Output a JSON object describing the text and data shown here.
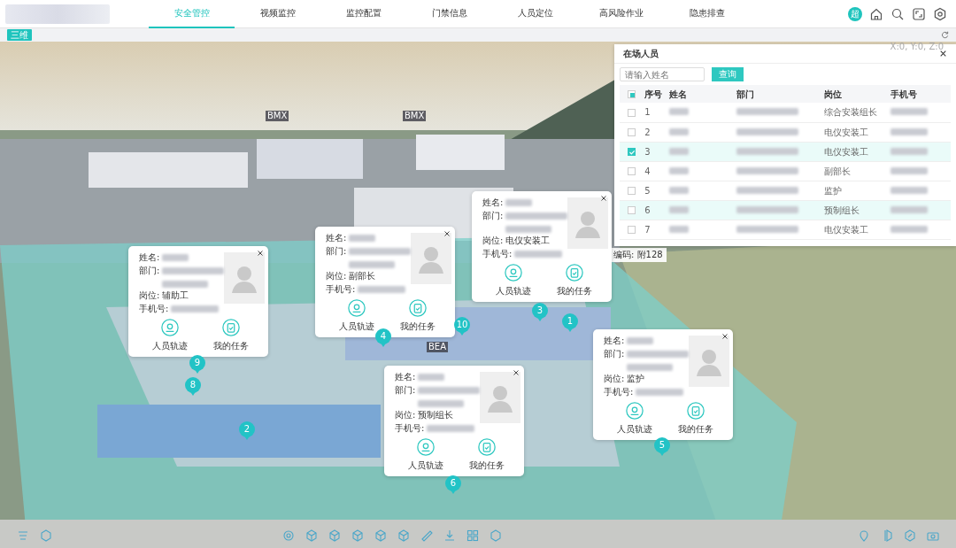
{
  "nav": {
    "tabs": [
      {
        "label": "安全管控",
        "selected": true
      },
      {
        "label": "视频监控",
        "selected": false
      },
      {
        "label": "监控配置",
        "selected": false
      },
      {
        "label": "门禁信息",
        "selected": false
      },
      {
        "label": "人员定位",
        "selected": false
      },
      {
        "label": "高风险作业",
        "selected": false
      },
      {
        "label": "隐患排查",
        "selected": false
      }
    ],
    "user_badge": "超"
  },
  "toolbar": {
    "view_button": "三维"
  },
  "scene": {
    "coordinates": "X:0, Y:0, Z:0",
    "building_labels": [
      "BMX",
      "BMX",
      "BEA"
    ],
    "tooltip": "编码: 附128",
    "markers": [
      "1",
      "2",
      "3",
      "4",
      "5",
      "6",
      "8",
      "9",
      "10"
    ]
  },
  "person_cards": [
    {
      "labels": [
        "姓名:",
        "部门:",
        "岗位:",
        "手机号:"
      ],
      "position": "辅助工",
      "actions": [
        "人员轨迹",
        "我的任务"
      ]
    },
    {
      "labels": [
        "姓名:",
        "部门:",
        "岗位:",
        "手机号:"
      ],
      "position": "副部长",
      "actions": [
        "人员轨迹",
        "我的任务"
      ]
    },
    {
      "labels": [
        "姓名:",
        "部门:",
        "岗位:",
        "手机号:"
      ],
      "position": "电仪安装工",
      "actions": [
        "人员轨迹",
        "我的任务"
      ]
    },
    {
      "labels": [
        "姓名:",
        "部门:",
        "岗位:",
        "手机号:"
      ],
      "position": "监护",
      "actions": [
        "人员轨迹",
        "我的任务"
      ]
    },
    {
      "labels": [
        "姓名:",
        "部门:",
        "岗位:",
        "手机号:"
      ],
      "position": "预制组长",
      "actions": [
        "人员轨迹",
        "我的任务"
      ]
    }
  ],
  "personnel_panel": {
    "title": "在场人员",
    "search": {
      "placeholder": "请输入姓名"
    },
    "search_button": "查询",
    "header_checkbox_indeterminate": true,
    "columns": [
      "序号",
      "姓名",
      "部门",
      "岗位",
      "手机号"
    ],
    "rows": [
      {
        "index": "1",
        "position": "综合安装组长",
        "checked": false,
        "highlighted": false
      },
      {
        "index": "2",
        "position": "电仪安装工",
        "checked": false,
        "highlighted": false
      },
      {
        "index": "3",
        "position": "电仪安装工",
        "checked": true,
        "highlighted": true
      },
      {
        "index": "4",
        "position": "副部长",
        "checked": false,
        "highlighted": false
      },
      {
        "index": "5",
        "position": "监护",
        "checked": false,
        "highlighted": false
      },
      {
        "index": "6",
        "position": "预制组长",
        "checked": false,
        "highlighted": true
      },
      {
        "index": "7",
        "position": "电仪安装工",
        "checked": false,
        "highlighted": false
      }
    ]
  }
}
